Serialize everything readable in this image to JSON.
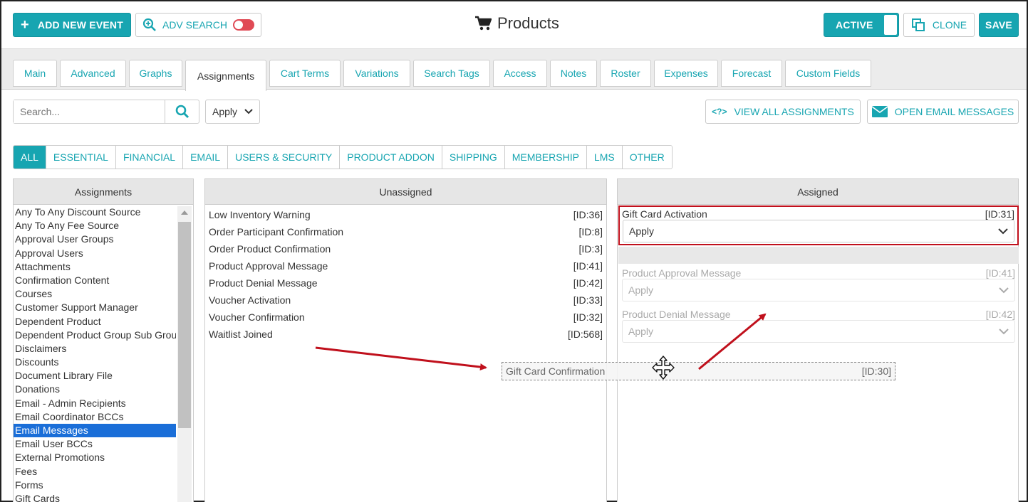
{
  "toolbar": {
    "add_event": "ADD NEW EVENT",
    "adv_search": "ADV SEARCH",
    "title": "Products",
    "active": "ACTIVE",
    "clone": "CLONE",
    "save": "SAVE"
  },
  "tabs": [
    "Main",
    "Advanced",
    "Graphs",
    "Assignments",
    "Cart Terms",
    "Variations",
    "Search Tags",
    "Access",
    "Notes",
    "Roster",
    "Expenses",
    "Forecast",
    "Custom Fields"
  ],
  "active_tab": "Assignments",
  "search": {
    "placeholder": "Search...",
    "filter_value": "Apply"
  },
  "actions": {
    "view_all": "VIEW ALL ASSIGNMENTS",
    "open_email": "OPEN EMAIL MESSAGES"
  },
  "filters": [
    "ALL",
    "ESSENTIAL",
    "FINANCIAL",
    "EMAIL",
    "USERS & SECURITY",
    "PRODUCT ADDON",
    "SHIPPING",
    "MEMBERSHIP",
    "LMS",
    "OTHER"
  ],
  "active_filter": "ALL",
  "panels": {
    "assignments_title": "Assignments",
    "unassigned_title": "Unassigned",
    "assigned_title": "Assigned"
  },
  "categories": [
    "Any To Any Discount Source",
    "Any To Any Fee Source",
    "Approval User Groups",
    "Approval Users",
    "Attachments",
    "Confirmation Content",
    "Courses",
    "Customer Support Manager",
    "Dependent Product",
    "Dependent Product Group Sub Grou",
    "Disclaimers",
    "Discounts",
    "Document Library File",
    "Donations",
    "Email - Admin Recipients",
    "Email Coordinator BCCs",
    "Email Messages",
    "Email User BCCs",
    "External Promotions",
    "Fees",
    "Forms",
    "Gift Cards"
  ],
  "selected_category": "Email Messages",
  "unassigned": [
    {
      "name": "Low Inventory Warning",
      "id": "[ID:36]"
    },
    {
      "name": "Order Participant Confirmation",
      "id": "[ID:8]"
    },
    {
      "name": "Order Product Confirmation",
      "id": "[ID:3]"
    },
    {
      "name": "Product Approval Message",
      "id": "[ID:41]"
    },
    {
      "name": "Product Denial Message",
      "id": "[ID:42]"
    },
    {
      "name": "Voucher Activation",
      "id": "[ID:33]"
    },
    {
      "name": "Voucher Confirmation",
      "id": "[ID:32]"
    },
    {
      "name": "Waitlist Joined",
      "id": "[ID:568]"
    }
  ],
  "assigned": [
    {
      "name": "Gift Card Activation",
      "id": "[ID:31]",
      "value": "Apply"
    },
    {
      "name": "Product Approval Message",
      "id": "[ID:41]",
      "value": "Apply"
    },
    {
      "name": "Product Denial Message",
      "id": "[ID:42]",
      "value": "Apply"
    }
  ],
  "dragging": {
    "name": "Gift Card Confirmation",
    "id": "[ID:30]"
  },
  "colors": {
    "accent": "#17a5b1",
    "highlight_border": "#c0101c",
    "selected": "#1a6ed8",
    "arrow": "#c0101c"
  }
}
